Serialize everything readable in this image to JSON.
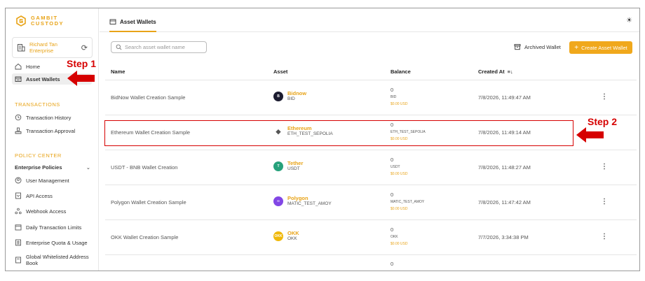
{
  "brand": {
    "line1": "GAMBIT",
    "line2": "CUSTODY",
    "color": "#e8a317"
  },
  "account": {
    "name_line1": "Richard Tan",
    "name_line2": "Enterprise",
    "refresh_icon": "refresh-icon"
  },
  "sidebar": {
    "items": [
      {
        "label": "Home",
        "icon": "home-icon"
      },
      {
        "label": "Asset Wallets",
        "icon": "wallet-icon",
        "active": true
      }
    ],
    "transactions_title": "TRANSACTIONS",
    "transactions": [
      {
        "label": "Transaction History",
        "icon": "history-icon"
      },
      {
        "label": "Transaction Approval",
        "icon": "approval-icon"
      }
    ],
    "policy_title": "POLICY CENTER",
    "enterprise_policies": "Enterprise Policies",
    "policies": [
      {
        "label": "User Management",
        "icon": "user-management-icon"
      },
      {
        "label": "API Access",
        "icon": "api-icon"
      },
      {
        "label": "Webhook Access",
        "icon": "webhook-icon"
      },
      {
        "label": "Daily Transaction Limits",
        "icon": "calendar-icon"
      },
      {
        "label": "Enterprise Quota & Usage",
        "icon": "quota-icon"
      },
      {
        "label_line1": "Global Whitelisted Address",
        "label_line2": "Book",
        "icon": "address-book-icon"
      }
    ]
  },
  "header": {
    "tab": "Asset Wallets",
    "theme_icon": "sun-icon"
  },
  "toolbar": {
    "search_placeholder": "Search asset wallet name",
    "archived": "Archived Wallet",
    "create": "Create Asset Wallet",
    "create_plus": "+"
  },
  "table": {
    "columns": [
      "Name",
      "Asset",
      "Balance",
      "Created At"
    ],
    "rows": [
      {
        "name": "BidNow Wallet Creation Sample",
        "asset": "Bidnow",
        "symbol": "BID",
        "balance": "0",
        "bal_sym": "BID",
        "usd": "$0.00 USD",
        "created": "7/8/2026, 11:49:47 AM",
        "coin_color": "#1b1b2f",
        "coin_text": "B"
      },
      {
        "name": "Ethereum Wallet Creation Sample",
        "asset": "Ethereum",
        "symbol": "ETH_TEST_SEPOLIA",
        "balance": "0",
        "bal_sym": "ETH_TEST_SEPOLIA",
        "usd": "$0.00 USD",
        "created": "7/8/2026, 11:49:14 AM",
        "coin_color": "#ffffff",
        "coin_text": "◆"
      },
      {
        "name": "USDT - BNB Wallet Creation",
        "asset": "Tether",
        "symbol": "USDT",
        "balance": "0",
        "bal_sym": "USDT",
        "usd": "$0.00 USD",
        "created": "7/8/2026, 11:48:27 AM",
        "coin_color": "#26a17b",
        "coin_text": "T"
      },
      {
        "name": "Polygon Wallet Creation Sample",
        "asset": "Polygon",
        "symbol": "MATIC_TEST_AMOY",
        "balance": "0",
        "bal_sym": "MATIC_TEST_AMOY",
        "usd": "$0.00 USD",
        "created": "7/8/2026, 11:47:42 AM",
        "coin_color": "#8247e5",
        "coin_text": "∞"
      },
      {
        "name": "OKK Wallet Creation Sample",
        "asset": "OKK",
        "symbol": "OKK",
        "balance": "0",
        "bal_sym": "OKK",
        "usd": "$0.00 USD",
        "created": "7/7/2026, 3:34:38 PM",
        "coin_color": "#f0b90b",
        "coin_text": "OKK"
      }
    ],
    "partial_balance": "0"
  },
  "annotations": {
    "step1": "Step 1",
    "step2": "Step 2",
    "color": "#d60000"
  }
}
